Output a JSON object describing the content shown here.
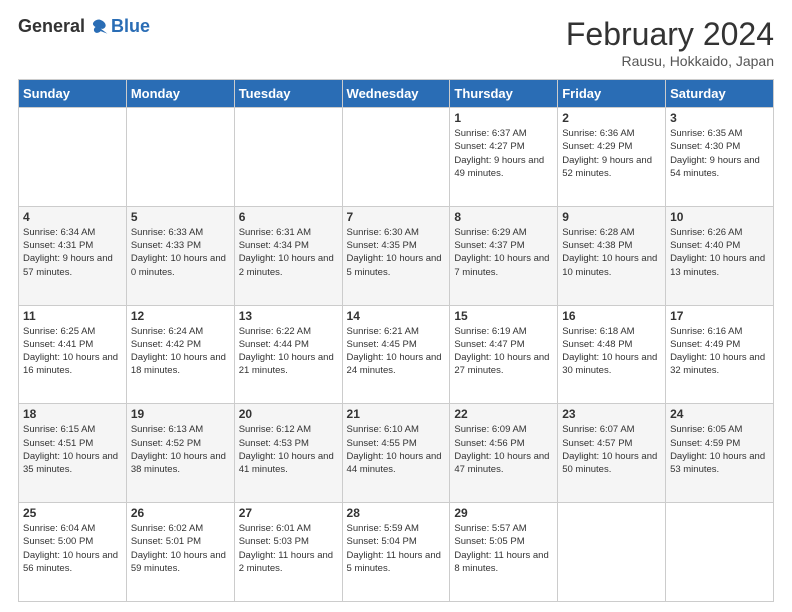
{
  "logo": {
    "general": "General",
    "blue": "Blue"
  },
  "header": {
    "month_year": "February 2024",
    "location": "Rausu, Hokkaido, Japan"
  },
  "weekdays": [
    "Sunday",
    "Monday",
    "Tuesday",
    "Wednesday",
    "Thursday",
    "Friday",
    "Saturday"
  ],
  "rows": [
    {
      "shade": "white",
      "cells": [
        {
          "day": "",
          "info": ""
        },
        {
          "day": "",
          "info": ""
        },
        {
          "day": "",
          "info": ""
        },
        {
          "day": "",
          "info": ""
        },
        {
          "day": "1",
          "info": "Sunrise: 6:37 AM\nSunset: 4:27 PM\nDaylight: 9 hours\nand 49 minutes."
        },
        {
          "day": "2",
          "info": "Sunrise: 6:36 AM\nSunset: 4:29 PM\nDaylight: 9 hours\nand 52 minutes."
        },
        {
          "day": "3",
          "info": "Sunrise: 6:35 AM\nSunset: 4:30 PM\nDaylight: 9 hours\nand 54 minutes."
        }
      ]
    },
    {
      "shade": "shaded",
      "cells": [
        {
          "day": "4",
          "info": "Sunrise: 6:34 AM\nSunset: 4:31 PM\nDaylight: 9 hours\nand 57 minutes."
        },
        {
          "day": "5",
          "info": "Sunrise: 6:33 AM\nSunset: 4:33 PM\nDaylight: 10 hours\nand 0 minutes."
        },
        {
          "day": "6",
          "info": "Sunrise: 6:31 AM\nSunset: 4:34 PM\nDaylight: 10 hours\nand 2 minutes."
        },
        {
          "day": "7",
          "info": "Sunrise: 6:30 AM\nSunset: 4:35 PM\nDaylight: 10 hours\nand 5 minutes."
        },
        {
          "day": "8",
          "info": "Sunrise: 6:29 AM\nSunset: 4:37 PM\nDaylight: 10 hours\nand 7 minutes."
        },
        {
          "day": "9",
          "info": "Sunrise: 6:28 AM\nSunset: 4:38 PM\nDaylight: 10 hours\nand 10 minutes."
        },
        {
          "day": "10",
          "info": "Sunrise: 6:26 AM\nSunset: 4:40 PM\nDaylight: 10 hours\nand 13 minutes."
        }
      ]
    },
    {
      "shade": "white",
      "cells": [
        {
          "day": "11",
          "info": "Sunrise: 6:25 AM\nSunset: 4:41 PM\nDaylight: 10 hours\nand 16 minutes."
        },
        {
          "day": "12",
          "info": "Sunrise: 6:24 AM\nSunset: 4:42 PM\nDaylight: 10 hours\nand 18 minutes."
        },
        {
          "day": "13",
          "info": "Sunrise: 6:22 AM\nSunset: 4:44 PM\nDaylight: 10 hours\nand 21 minutes."
        },
        {
          "day": "14",
          "info": "Sunrise: 6:21 AM\nSunset: 4:45 PM\nDaylight: 10 hours\nand 24 minutes."
        },
        {
          "day": "15",
          "info": "Sunrise: 6:19 AM\nSunset: 4:47 PM\nDaylight: 10 hours\nand 27 minutes."
        },
        {
          "day": "16",
          "info": "Sunrise: 6:18 AM\nSunset: 4:48 PM\nDaylight: 10 hours\nand 30 minutes."
        },
        {
          "day": "17",
          "info": "Sunrise: 6:16 AM\nSunset: 4:49 PM\nDaylight: 10 hours\nand 32 minutes."
        }
      ]
    },
    {
      "shade": "shaded",
      "cells": [
        {
          "day": "18",
          "info": "Sunrise: 6:15 AM\nSunset: 4:51 PM\nDaylight: 10 hours\nand 35 minutes."
        },
        {
          "day": "19",
          "info": "Sunrise: 6:13 AM\nSunset: 4:52 PM\nDaylight: 10 hours\nand 38 minutes."
        },
        {
          "day": "20",
          "info": "Sunrise: 6:12 AM\nSunset: 4:53 PM\nDaylight: 10 hours\nand 41 minutes."
        },
        {
          "day": "21",
          "info": "Sunrise: 6:10 AM\nSunset: 4:55 PM\nDaylight: 10 hours\nand 44 minutes."
        },
        {
          "day": "22",
          "info": "Sunrise: 6:09 AM\nSunset: 4:56 PM\nDaylight: 10 hours\nand 47 minutes."
        },
        {
          "day": "23",
          "info": "Sunrise: 6:07 AM\nSunset: 4:57 PM\nDaylight: 10 hours\nand 50 minutes."
        },
        {
          "day": "24",
          "info": "Sunrise: 6:05 AM\nSunset: 4:59 PM\nDaylight: 10 hours\nand 53 minutes."
        }
      ]
    },
    {
      "shade": "white",
      "cells": [
        {
          "day": "25",
          "info": "Sunrise: 6:04 AM\nSunset: 5:00 PM\nDaylight: 10 hours\nand 56 minutes."
        },
        {
          "day": "26",
          "info": "Sunrise: 6:02 AM\nSunset: 5:01 PM\nDaylight: 10 hours\nand 59 minutes."
        },
        {
          "day": "27",
          "info": "Sunrise: 6:01 AM\nSunset: 5:03 PM\nDaylight: 11 hours\nand 2 minutes."
        },
        {
          "day": "28",
          "info": "Sunrise: 5:59 AM\nSunset: 5:04 PM\nDaylight: 11 hours\nand 5 minutes."
        },
        {
          "day": "29",
          "info": "Sunrise: 5:57 AM\nSunset: 5:05 PM\nDaylight: 11 hours\nand 8 minutes."
        },
        {
          "day": "",
          "info": ""
        },
        {
          "day": "",
          "info": ""
        }
      ]
    }
  ]
}
